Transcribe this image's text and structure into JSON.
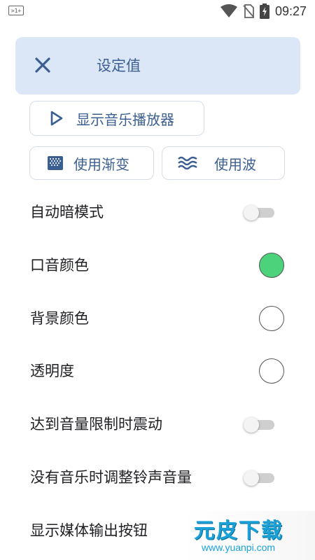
{
  "status_bar": {
    "notification_badge": ">1+",
    "time": "09:27",
    "icons": [
      "wifi-icon",
      "no-sim-icon",
      "battery-charging-icon"
    ]
  },
  "header": {
    "close_icon": "close-icon",
    "title": "设定值",
    "background_color": "#dbe6f6",
    "accent_color": "#3c5f92"
  },
  "buttons": {
    "show_player": {
      "label": "显示音乐播放器",
      "icon": "play-outline-icon"
    },
    "use_gradient": {
      "label": "使用渐变",
      "icon": "gradient-icon"
    },
    "use_wave": {
      "label": "使用波",
      "icon": "wave-icon"
    }
  },
  "settings": [
    {
      "label": "自动暗模式",
      "control": "toggle",
      "on": false
    },
    {
      "label": "口音颜色",
      "control": "color",
      "color": "#4cd27a"
    },
    {
      "label": "背景颜色",
      "control": "color",
      "color": "#ffffff"
    },
    {
      "label": "透明度",
      "control": "color",
      "color": "#ffffff"
    },
    {
      "label": "达到音量限制时震动",
      "control": "toggle",
      "on": false
    },
    {
      "label": "没有音乐时调整铃声音量",
      "control": "toggle",
      "on": false
    },
    {
      "label": "显示媒体输出按钮",
      "control": "toggle",
      "on": false
    }
  ],
  "watermark": {
    "text": "元皮下载",
    "url": "www.yuanpi.com"
  }
}
